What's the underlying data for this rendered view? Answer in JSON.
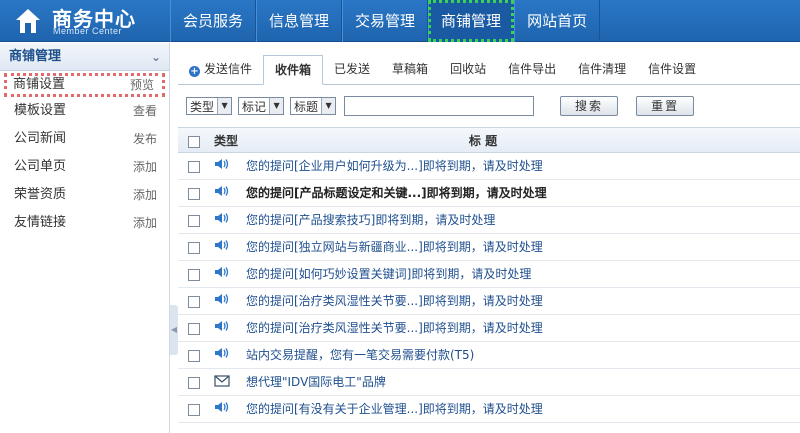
{
  "header": {
    "logo_title": "商务中心",
    "logo_subtitle": "Member Center",
    "nav": [
      {
        "label": "会员服务"
      },
      {
        "label": "信息管理"
      },
      {
        "label": "交易管理"
      },
      {
        "label": "商铺管理",
        "active": true
      },
      {
        "label": "网站首页"
      }
    ]
  },
  "sidebar": {
    "title": "商铺管理",
    "items": [
      {
        "label": "商铺设置",
        "link": "预览"
      },
      {
        "label": "模板设置",
        "link": "查看"
      },
      {
        "label": "公司新闻",
        "link": "发布"
      },
      {
        "label": "公司单页",
        "link": "添加"
      },
      {
        "label": "荣誉资质",
        "link": "添加"
      },
      {
        "label": "友情链接",
        "link": "添加"
      }
    ]
  },
  "tabs": [
    {
      "label": "发送信件"
    },
    {
      "label": "收件箱",
      "active": true
    },
    {
      "label": "已发送"
    },
    {
      "label": "草稿箱"
    },
    {
      "label": "回收站"
    },
    {
      "label": "信件导出"
    },
    {
      "label": "信件清理"
    },
    {
      "label": "信件设置"
    }
  ],
  "filters": {
    "type_label": "类型",
    "mark_label": "标记",
    "title_label": "标题",
    "search_value": "",
    "search_button": "搜索",
    "reset_button": "重置"
  },
  "table": {
    "col_type": "类型",
    "col_title": "标 题",
    "rows": [
      {
        "icon": "speaker-icon",
        "title": "您的提问[企业用户如何升级为...]即将到期，请及时处理"
      },
      {
        "icon": "speaker-icon",
        "title": "您的提问[产品标题设定和关键...]即将到期，请及时处理",
        "bold": true
      },
      {
        "icon": "speaker-icon",
        "title": "您的提问[产品搜索技巧]即将到期，请及时处理"
      },
      {
        "icon": "speaker-icon",
        "title": "您的提问[独立网站与新疆商业...]即将到期，请及时处理"
      },
      {
        "icon": "speaker-icon",
        "title": "您的提问[如何巧妙设置关键词]即将到期，请及时处理"
      },
      {
        "icon": "speaker-icon",
        "title": "您的提问[治疗类风湿性关节要...]即将到期，请及时处理"
      },
      {
        "icon": "speaker-icon",
        "title": "您的提问[治疗类风湿性关节要...]即将到期，请及时处理"
      },
      {
        "icon": "speaker-icon",
        "title": "站内交易提醒，您有一笔交易需要付款(T5)"
      },
      {
        "icon": "mail-icon",
        "title": "想代理\"IDV国际电工\"品牌"
      },
      {
        "icon": "speaker-icon",
        "title": "您的提问[有没有关于企业管理...]即将到期，请及时处理"
      }
    ]
  },
  "colors": {
    "header_blue": "#2370c0",
    "active_nav_outline": "#39d353",
    "selected_sidebar_outline": "#e36a6a",
    "link_blue": "#1f4f8e"
  }
}
